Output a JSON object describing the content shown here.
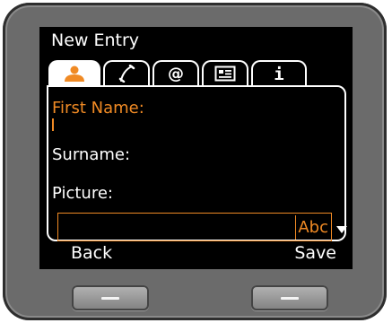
{
  "header": {
    "title": "New Entry"
  },
  "tabs": [
    {
      "icon": "person-icon",
      "active": true
    },
    {
      "icon": "phone-handset-icon",
      "active": false
    },
    {
      "icon": "at-sign-icon",
      "active": false
    },
    {
      "icon": "contact-card-icon",
      "active": false
    },
    {
      "icon": "info-icon",
      "active": false
    }
  ],
  "form": {
    "first_name_label": "First Name:",
    "first_name_value": "",
    "surname_label": "Surname:",
    "picture_label": "Picture:",
    "input_mode": "Abc"
  },
  "softkeys": {
    "left": "Back",
    "right": "Save"
  },
  "colors": {
    "accent": "#f08a24",
    "screen": "#000000",
    "bezel": "#6b6b6b",
    "text": "#ffffff"
  }
}
